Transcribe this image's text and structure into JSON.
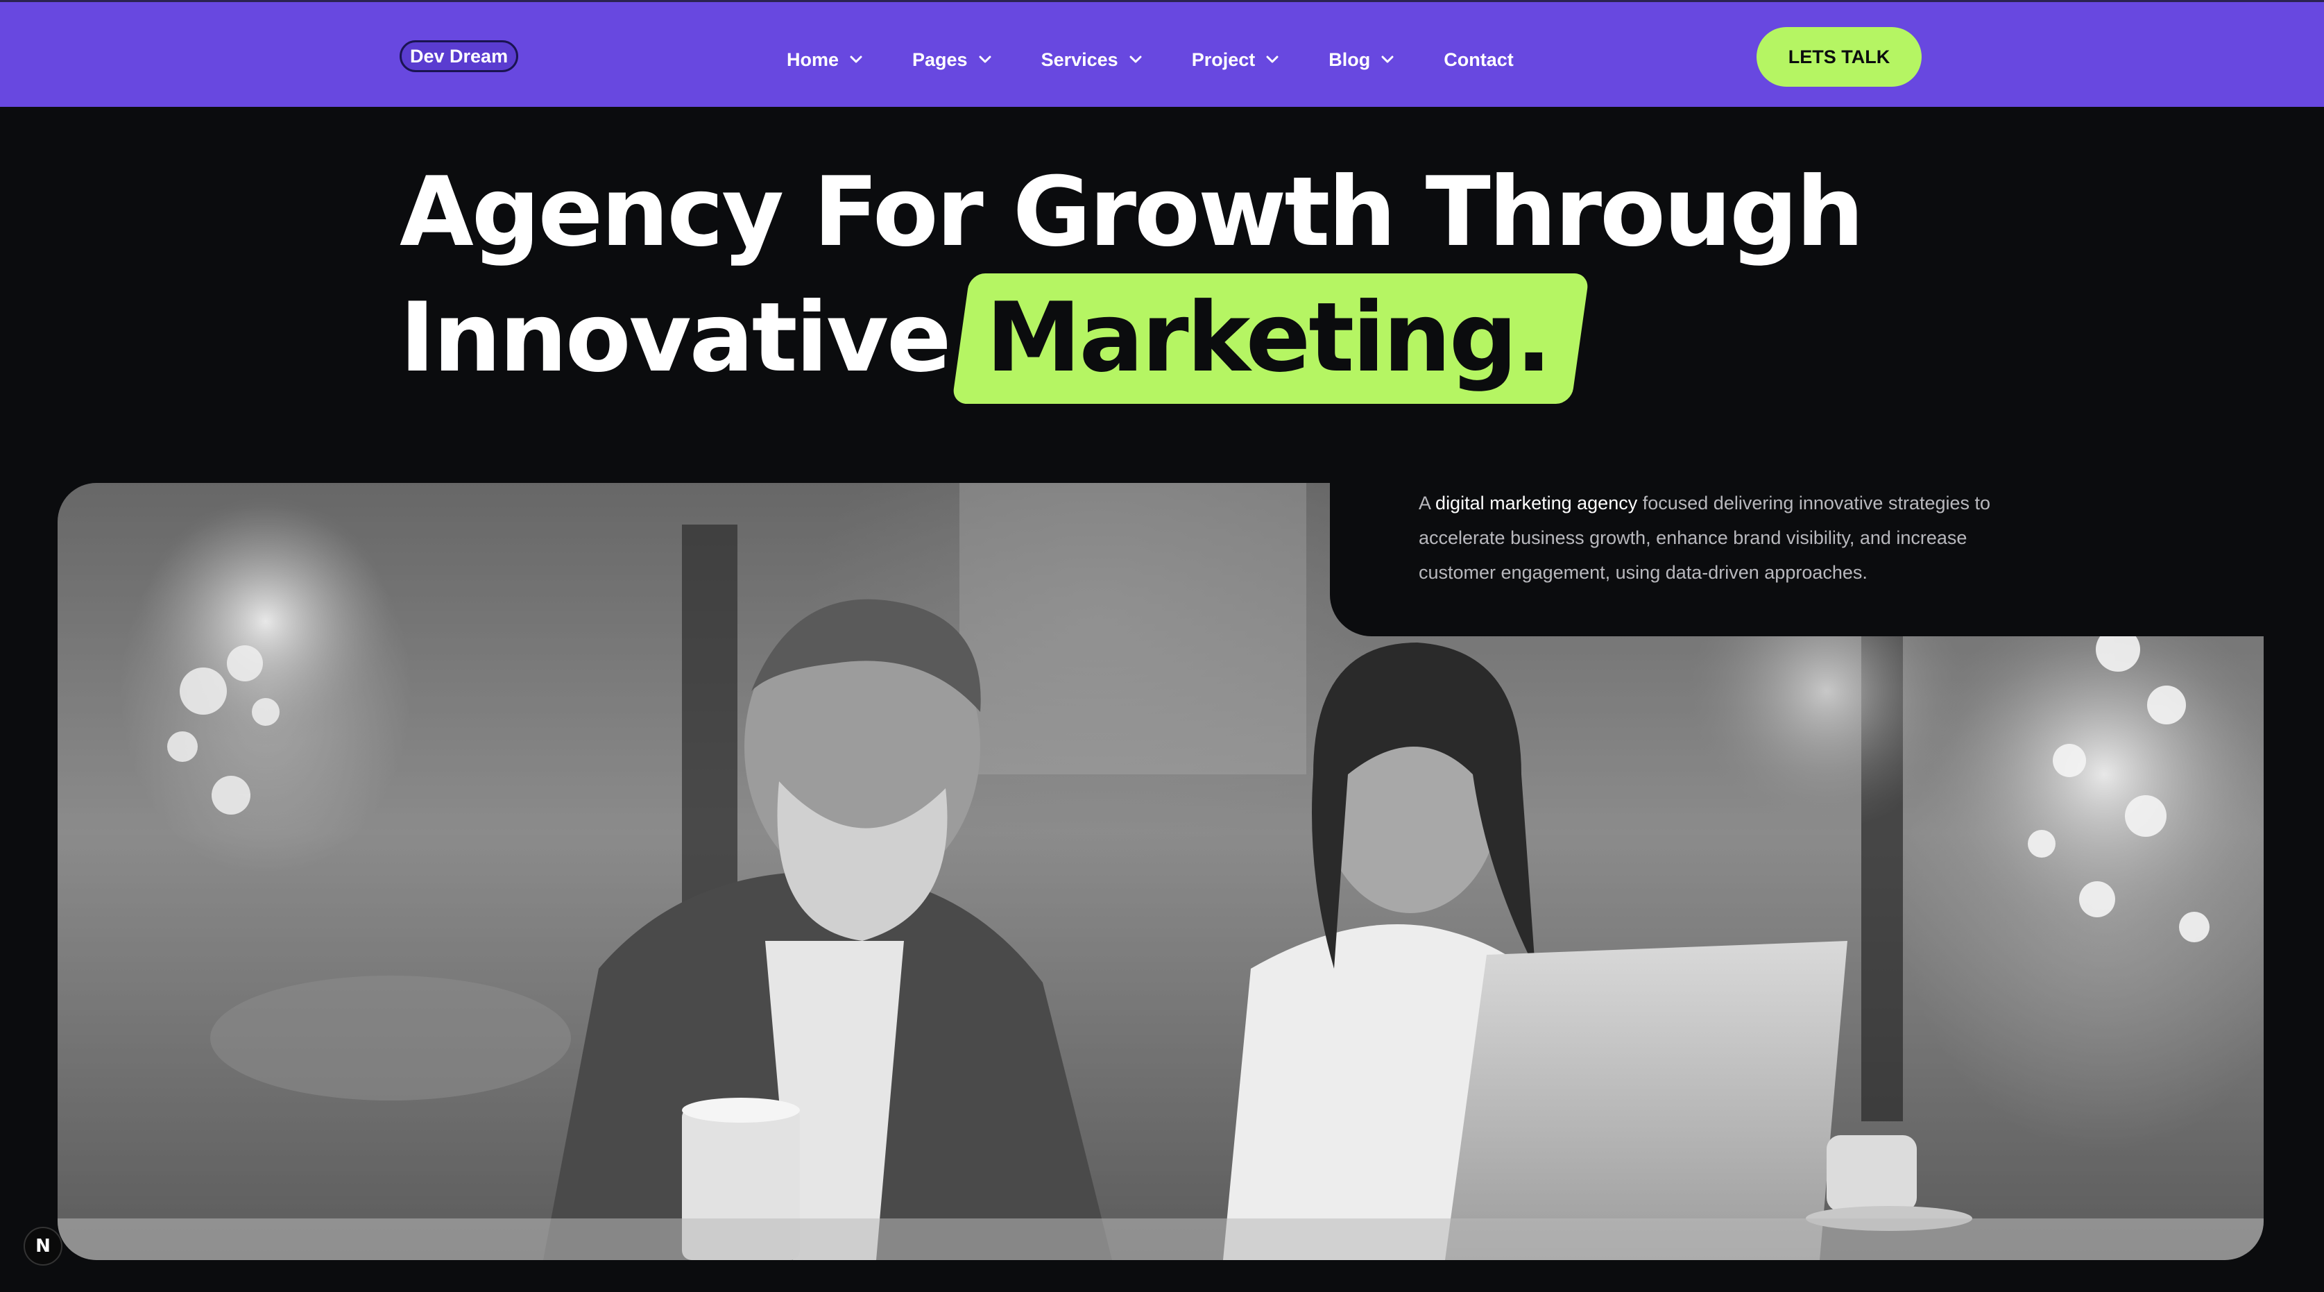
{
  "brand": {
    "logo_text": "Dev Dream"
  },
  "nav": {
    "items": [
      {
        "label": "Home",
        "has_dropdown": true
      },
      {
        "label": "Pages",
        "has_dropdown": true
      },
      {
        "label": "Services",
        "has_dropdown": true
      },
      {
        "label": "Project",
        "has_dropdown": true
      },
      {
        "label": "Blog",
        "has_dropdown": true
      },
      {
        "label": "Contact",
        "has_dropdown": false
      }
    ],
    "cta_label": "LETS TALK"
  },
  "hero": {
    "title_line1": "Agency For Growth Through",
    "title_line2_plain": "Innovative",
    "title_line2_highlight": "Marketing.",
    "description_prefix": "A",
    "description_strong": "digital marketing agency",
    "description_rest": "focused delivering innovative strategies to accelerate business growth, enhance brand visibility, and increase customer engagement, using data-driven approaches."
  },
  "badge": {
    "text": "N"
  },
  "colors": {
    "nav_bg": "#6848e0",
    "accent": "#b5f563",
    "page_bg": "#0b0c0e",
    "muted_text": "#b8b8bd"
  },
  "icons": {
    "dropdown": "chevron-down-icon"
  }
}
